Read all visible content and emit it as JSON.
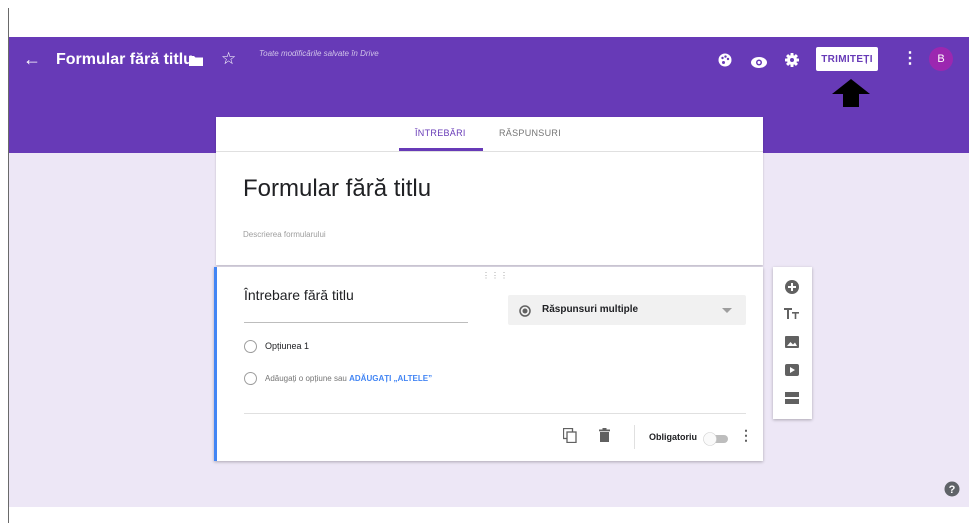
{
  "header": {
    "back_icon": "arrow-back-icon",
    "title": "Formular fără titlu",
    "saved_status": "Toate modificările salvate în Drive",
    "send_label": "TRIMITEȚI",
    "avatar_initial": "B",
    "colors": {
      "primary": "#673ab7",
      "send_text": "#673ab7",
      "avatar": "#9c27b0"
    },
    "icons": [
      "folder-icon",
      "star-icon",
      "palette-icon",
      "eye-icon",
      "gear-icon",
      "more-vert-icon"
    ]
  },
  "tabs": [
    {
      "label": "ÎNTREBĂRI",
      "active": true
    },
    {
      "label": "RĂSPUNSURI",
      "active": false
    }
  ],
  "form": {
    "title": "Formular fără titlu",
    "description_placeholder": "Descrierea formularului"
  },
  "question": {
    "title": "Întrebare fără titlu",
    "type_label": "Răspunsuri multiple",
    "options": [
      {
        "label": "Opțiunea 1"
      }
    ],
    "add_option_text": "Adăugați o opțiune",
    "add_option_sep": "sau",
    "add_other_link": "ADĂUGAȚI „ALTELE”",
    "required_label": "Obligatoriu",
    "required": false,
    "accent_color": "#4285f4"
  },
  "side_toolbar": {
    "icons": [
      "add-question-icon",
      "title-text-icon",
      "image-icon",
      "video-icon",
      "section-icon"
    ]
  }
}
